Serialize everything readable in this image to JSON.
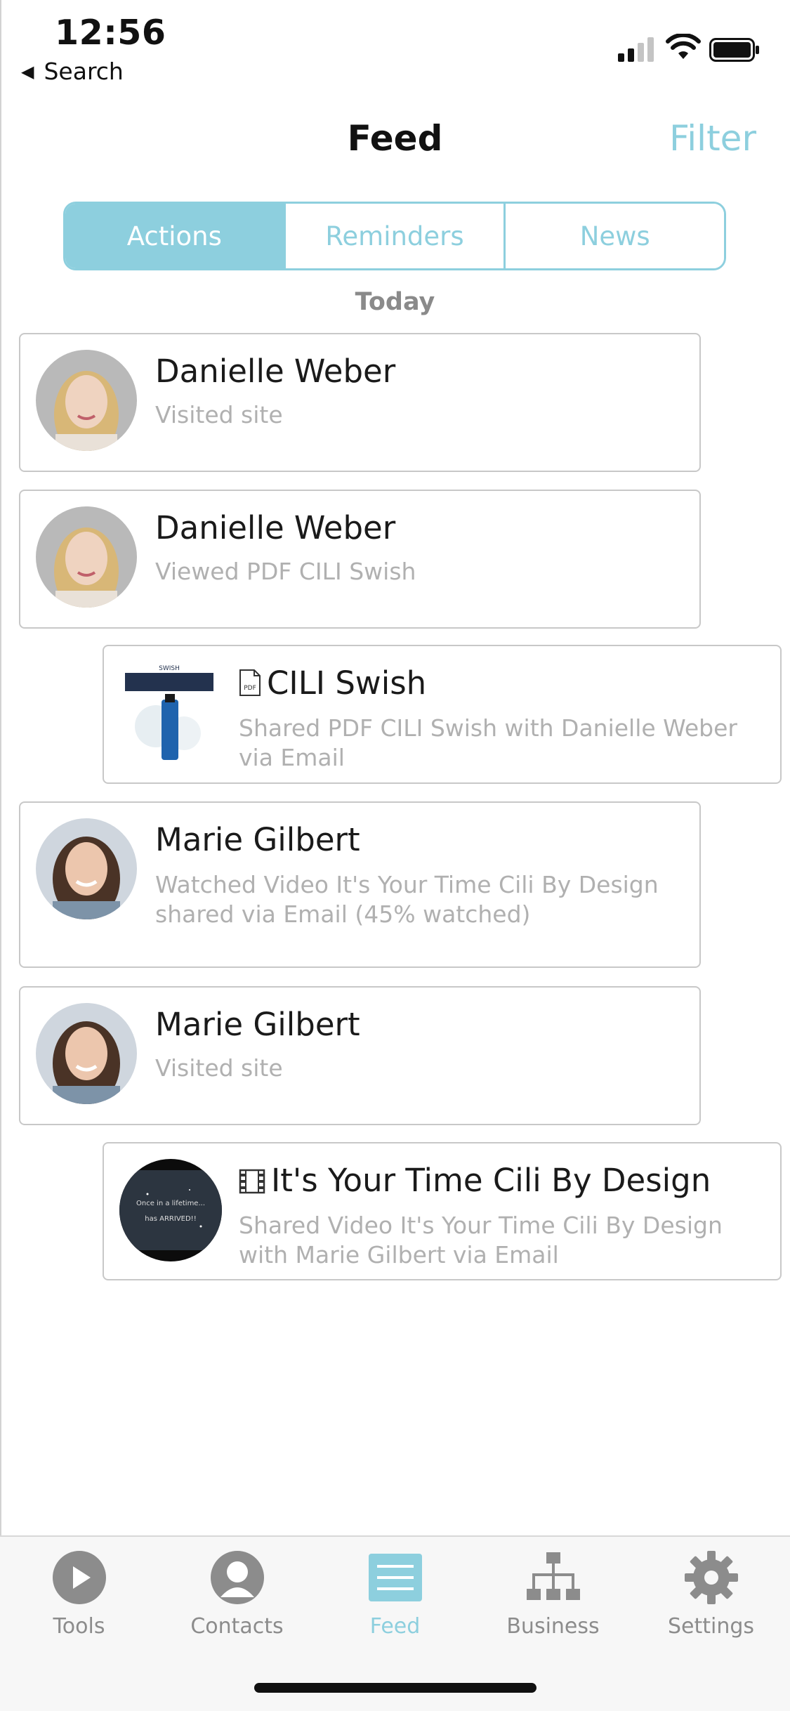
{
  "status_bar": {
    "time": "12:56",
    "back_label": "Search"
  },
  "nav": {
    "title": "Feed",
    "filter_label": "Filter"
  },
  "segments": {
    "actions": "Actions",
    "reminders": "Reminders",
    "news": "News",
    "selected": "Actions"
  },
  "section_header": "Today",
  "feed": [
    {
      "title": "Danielle Weber",
      "subtitle": "Visited site"
    },
    {
      "title": "Danielle Weber",
      "subtitle": "Viewed PDF CILI Swish"
    },
    {
      "title": "CILI Swish",
      "title_icon": "pdf-file-icon",
      "subtitle": "Shared PDF CILI Swish with Danielle Weber via Email",
      "thumb_text": "SWISH"
    },
    {
      "title": "Marie Gilbert",
      "subtitle": "Watched Video It's Your Time Cili By Design shared via Email (45% watched)"
    },
    {
      "title": "Marie Gilbert",
      "subtitle": "Visited site"
    },
    {
      "title": "It's Your Time Cili By Design",
      "title_icon": "film-icon",
      "subtitle": "Shared Video It's Your Time Cili By Design with Marie Gilbert via Email",
      "thumb_line1": "Once in a lifetime...",
      "thumb_line2": "has ARRIVED!!"
    }
  ],
  "tabbar": {
    "tools": "Tools",
    "contacts": "Contacts",
    "feed": "Feed",
    "business": "Business",
    "settings": "Settings",
    "selected": "Feed"
  },
  "colors": {
    "accent": "#8dcfde",
    "muted_text": "#b0b0b0",
    "tab_inactive": "#8c8c8c"
  }
}
